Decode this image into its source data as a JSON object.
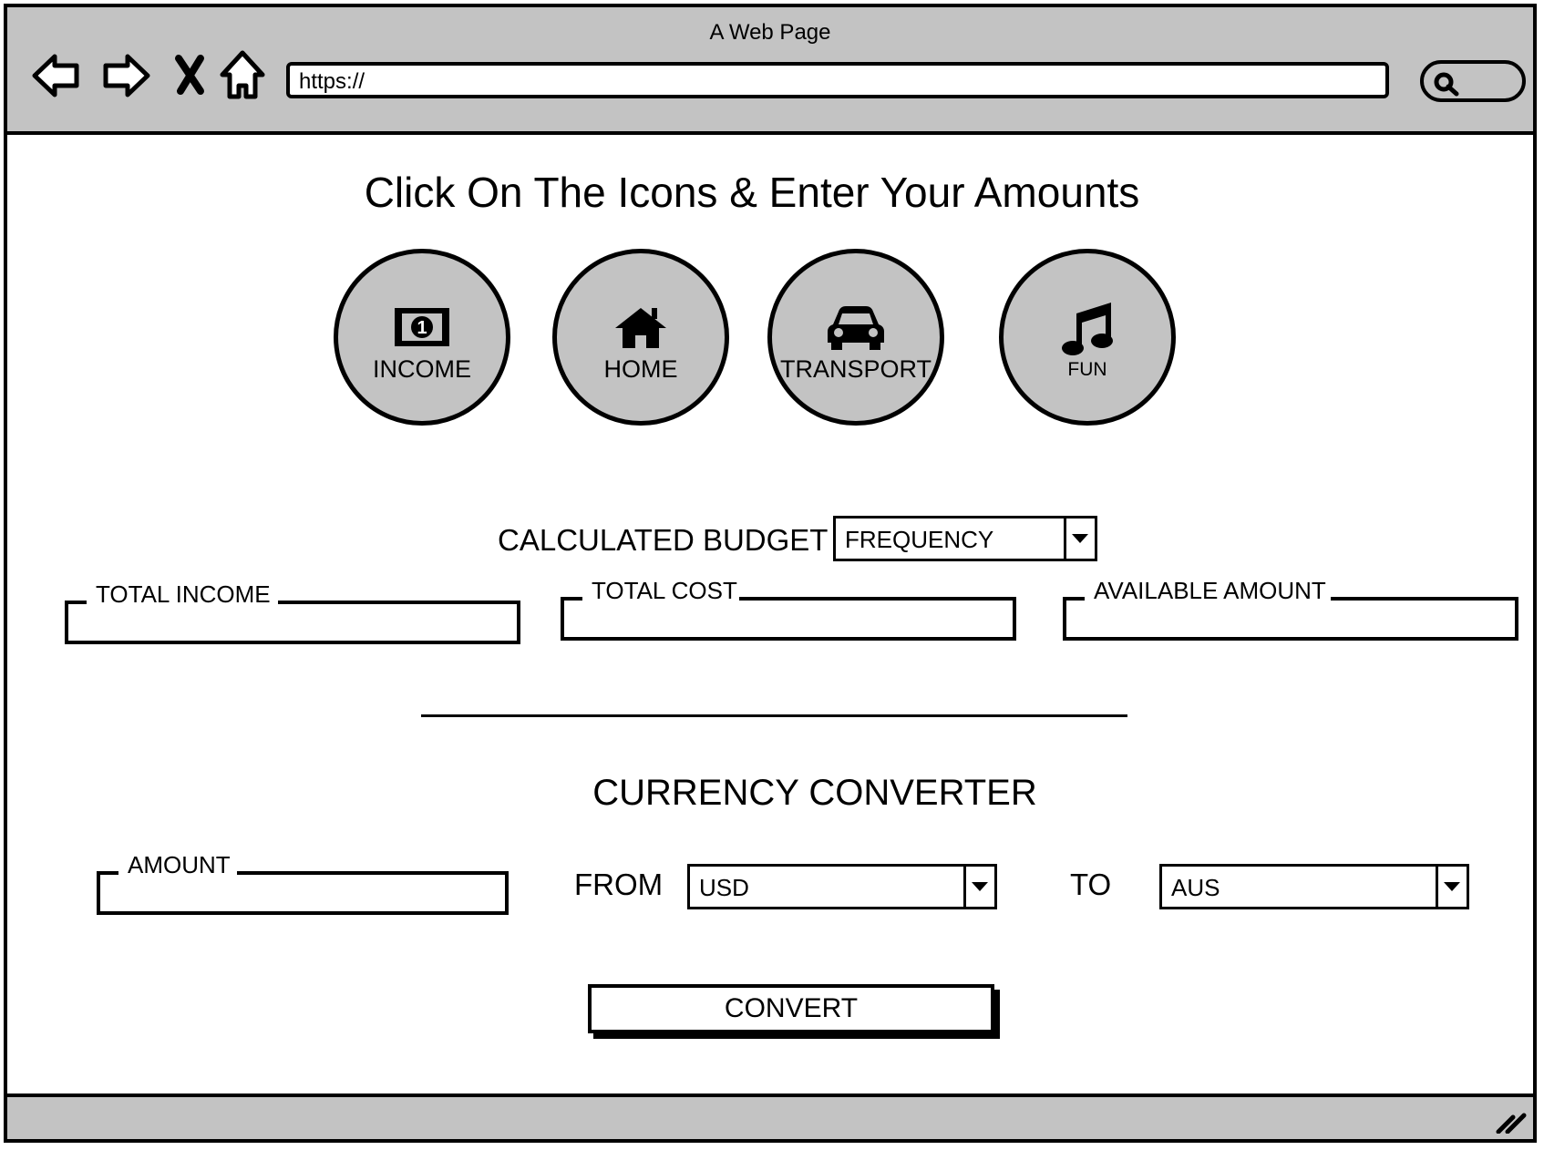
{
  "window": {
    "title": "A Web Page"
  },
  "browser": {
    "url": "https://",
    "nav": [
      "back-arrow-icon",
      "forward-arrow-icon",
      "close-x-icon",
      "home-icon"
    ],
    "search_icon": "search-icon"
  },
  "main": {
    "heading": "Click On The Icons & Enter Your Amounts",
    "categories": [
      {
        "label": "INCOME",
        "icon": "money-bill-icon"
      },
      {
        "label": "HOME",
        "icon": "house-icon"
      },
      {
        "label": "TRANSPORT",
        "icon": "car-icon"
      },
      {
        "label": "FUN",
        "icon": "music-note-icon"
      }
    ]
  },
  "budget": {
    "label": "CALCULATED BUDGET",
    "frequency_select": "FREQUENCY",
    "fields": [
      {
        "legend": "TOTAL INCOME",
        "value": ""
      },
      {
        "legend": "TOTAL COST",
        "value": ""
      },
      {
        "legend": "AVAILABLE AMOUNT",
        "value": ""
      }
    ]
  },
  "converter": {
    "title": "CURRENCY CONVERTER",
    "amount_legend": "AMOUNT",
    "amount_value": "",
    "from_label": "FROM",
    "from_value": "USD",
    "to_label": "TO",
    "to_value": "AUS",
    "convert_label": "CONVERT"
  },
  "colors": {
    "chrome": "#c3c3c3",
    "ink": "#000000",
    "canvas": "#ffffff"
  }
}
